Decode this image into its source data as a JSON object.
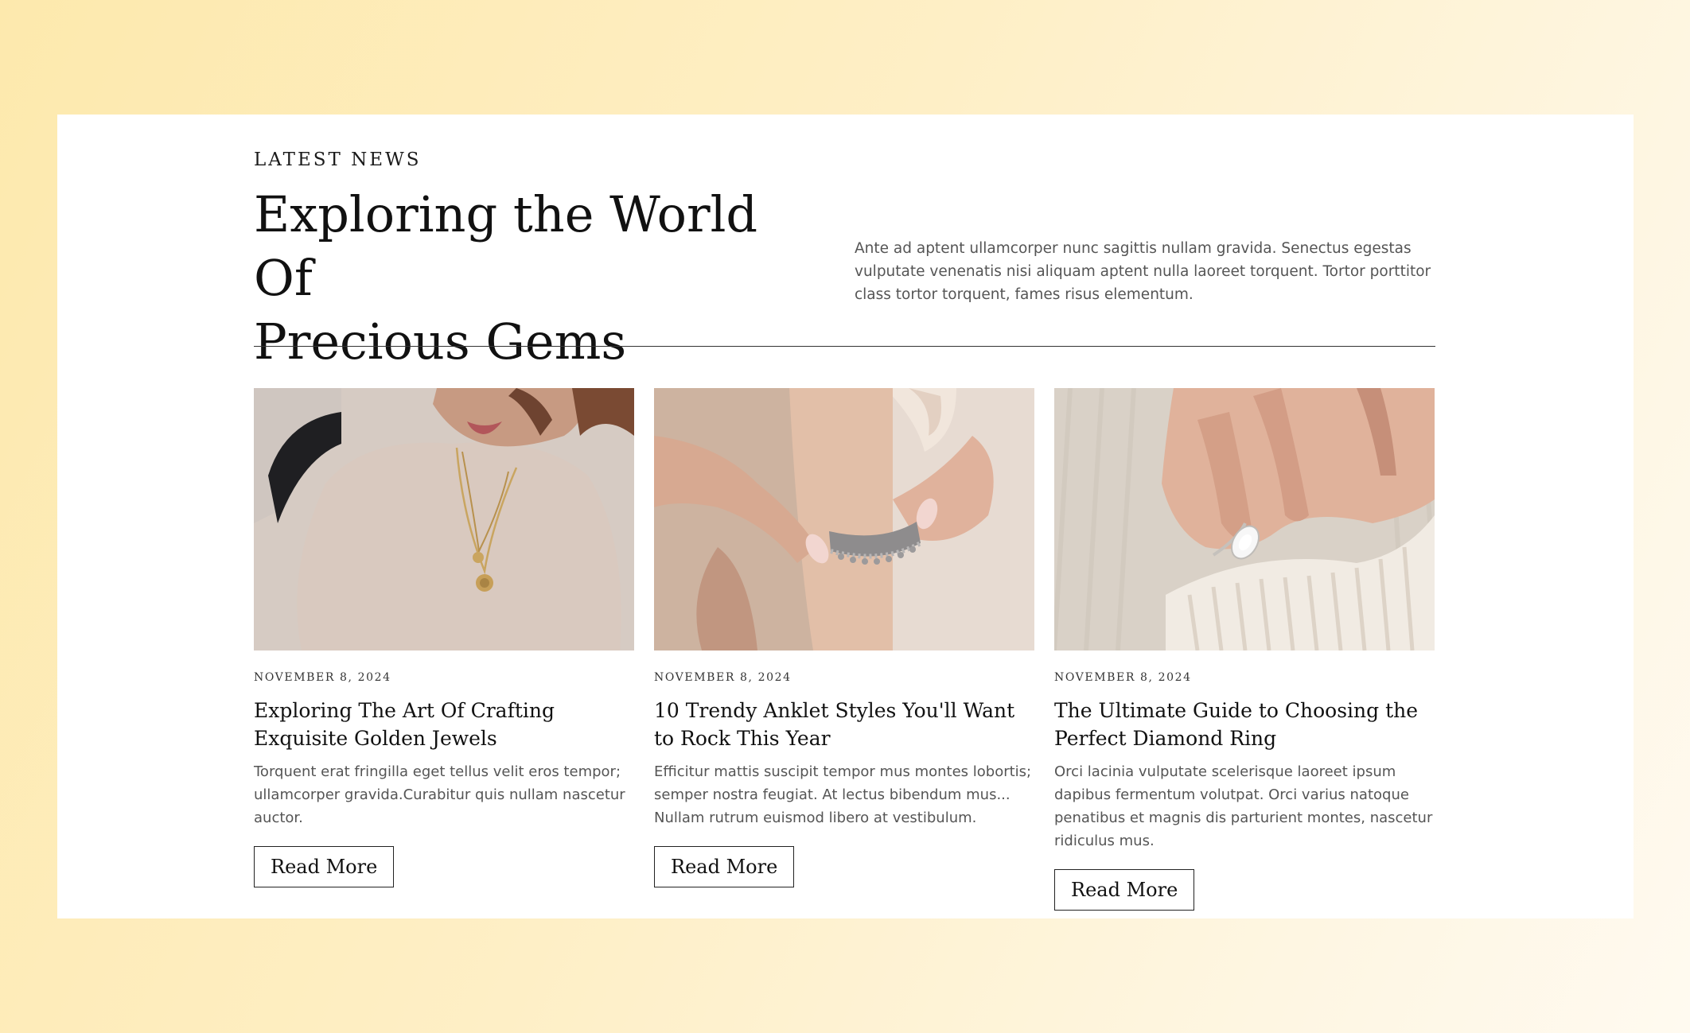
{
  "section": {
    "eyebrow": "LATEST NEWS",
    "headline_line1": "Exploring the World Of",
    "headline_line2": "Precious Gems",
    "intro": "Ante ad aptent ullamcorper nunc sagittis nullam gravida. Senectus egestas vulputate venenatis nisi aliquam aptent nulla laoreet torquent. Tortor porttitor class tortor torquent, fames risus elementum."
  },
  "posts": [
    {
      "date": "NOVEMBER 8, 2024",
      "title": "Exploring The Art Of Crafting Exquisite Golden Jewels",
      "excerpt": "Torquent erat fringilla eget tellus velit eros tempor; ullamcorper gravida.Curabitur quis nullam nascetur auctor.",
      "button": "Read More",
      "image": "woman-gold-necklaces-photo"
    },
    {
      "date": "NOVEMBER 8, 2024",
      "title": "10 Trendy Anklet Styles You'll Want to Rock This Year",
      "excerpt": "Efficitur mattis suscipit tempor mus montes lobortis; semper nostra feugiat. At lectus bibendum mus...  Nullam rutrum euismod libero at vestibulum.",
      "button": "Read More",
      "image": "hands-fastening-anklet-photo"
    },
    {
      "date": "NOVEMBER 8, 2024",
      "title": "The Ultimate Guide to Choosing the Perfect Diamond Ring",
      "excerpt": "Orci lacinia vulputate scelerisque laoreet ipsum dapibus fermentum volutpat. Orci varius natoque penatibus et magnis dis parturient montes, nascetur ridiculus mus.",
      "button": "Read More",
      "image": "hand-diamond-ring-photo"
    }
  ],
  "colors": {
    "background_start": "#fde9ad",
    "background_end": "#fffaf0",
    "panel": "#ffffff",
    "text": "#111111",
    "muted": "#555555"
  }
}
